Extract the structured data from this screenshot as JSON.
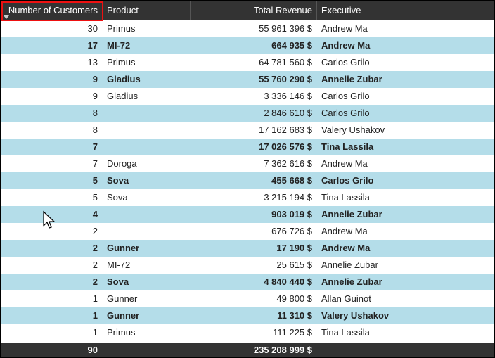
{
  "columns": {
    "c1": "Number of Customers",
    "c2": "Product",
    "c3": "Total Revenue",
    "c4": "Executive"
  },
  "chart_data": {
    "type": "table",
    "columns": [
      "Number of Customers",
      "Product",
      "Total Revenue",
      "Executive"
    ],
    "rows": [
      {
        "customers": 30,
        "product": "Primus",
        "revenue": "55 961 396 $",
        "exec": "Andrew Ma"
      },
      {
        "customers": 17,
        "product": "MI-72",
        "revenue": "664 935 $",
        "exec": "Andrew Ma"
      },
      {
        "customers": 13,
        "product": "Primus",
        "revenue": "64 781 560 $",
        "exec": "Carlos Grilo"
      },
      {
        "customers": 9,
        "product": "Gladius",
        "revenue": "55 760 290 $",
        "exec": "Annelie Zubar"
      },
      {
        "customers": 9,
        "product": "Gladius",
        "revenue": "3 336 146 $",
        "exec": "Carlos Grilo"
      },
      {
        "customers": 8,
        "product": "",
        "revenue": "2 846 610 $",
        "exec": "Carlos Grilo"
      },
      {
        "customers": 8,
        "product": "",
        "revenue": "17 162 683 $",
        "exec": "Valery Ushakov"
      },
      {
        "customers": 7,
        "product": "",
        "revenue": "17 026 576 $",
        "exec": "Tina Lassila"
      },
      {
        "customers": 7,
        "product": "Doroga",
        "revenue": "7 362 616 $",
        "exec": "Andrew Ma"
      },
      {
        "customers": 5,
        "product": "Sova",
        "revenue": "455 668 $",
        "exec": "Carlos Grilo"
      },
      {
        "customers": 5,
        "product": "Sova",
        "revenue": "3 215 194 $",
        "exec": "Tina Lassila"
      },
      {
        "customers": 4,
        "product": "",
        "revenue": "903 019 $",
        "exec": "Annelie Zubar"
      },
      {
        "customers": 2,
        "product": "",
        "revenue": "676 726 $",
        "exec": "Andrew Ma"
      },
      {
        "customers": 2,
        "product": "Gunner",
        "revenue": "17 190 $",
        "exec": "Andrew Ma"
      },
      {
        "customers": 2,
        "product": "MI-72",
        "revenue": "25 615 $",
        "exec": "Annelie Zubar"
      },
      {
        "customers": 2,
        "product": "Sova",
        "revenue": "4 840 440 $",
        "exec": "Annelie Zubar"
      },
      {
        "customers": 1,
        "product": "Gunner",
        "revenue": "49 800 $",
        "exec": "Allan Guinot"
      },
      {
        "customers": 1,
        "product": "Gunner",
        "revenue": "11 310 $",
        "exec": "Valery Ushakov"
      },
      {
        "customers": 1,
        "product": "Primus",
        "revenue": "111 225 $",
        "exec": "Tina Lassila"
      }
    ],
    "totals": {
      "customers": 90,
      "revenue": "235 208 999 $"
    },
    "sort": {
      "column": "Number of Customers",
      "direction": "desc"
    }
  },
  "bold_row_indices": [
    1,
    3,
    7,
    9,
    11,
    13,
    15,
    17
  ]
}
